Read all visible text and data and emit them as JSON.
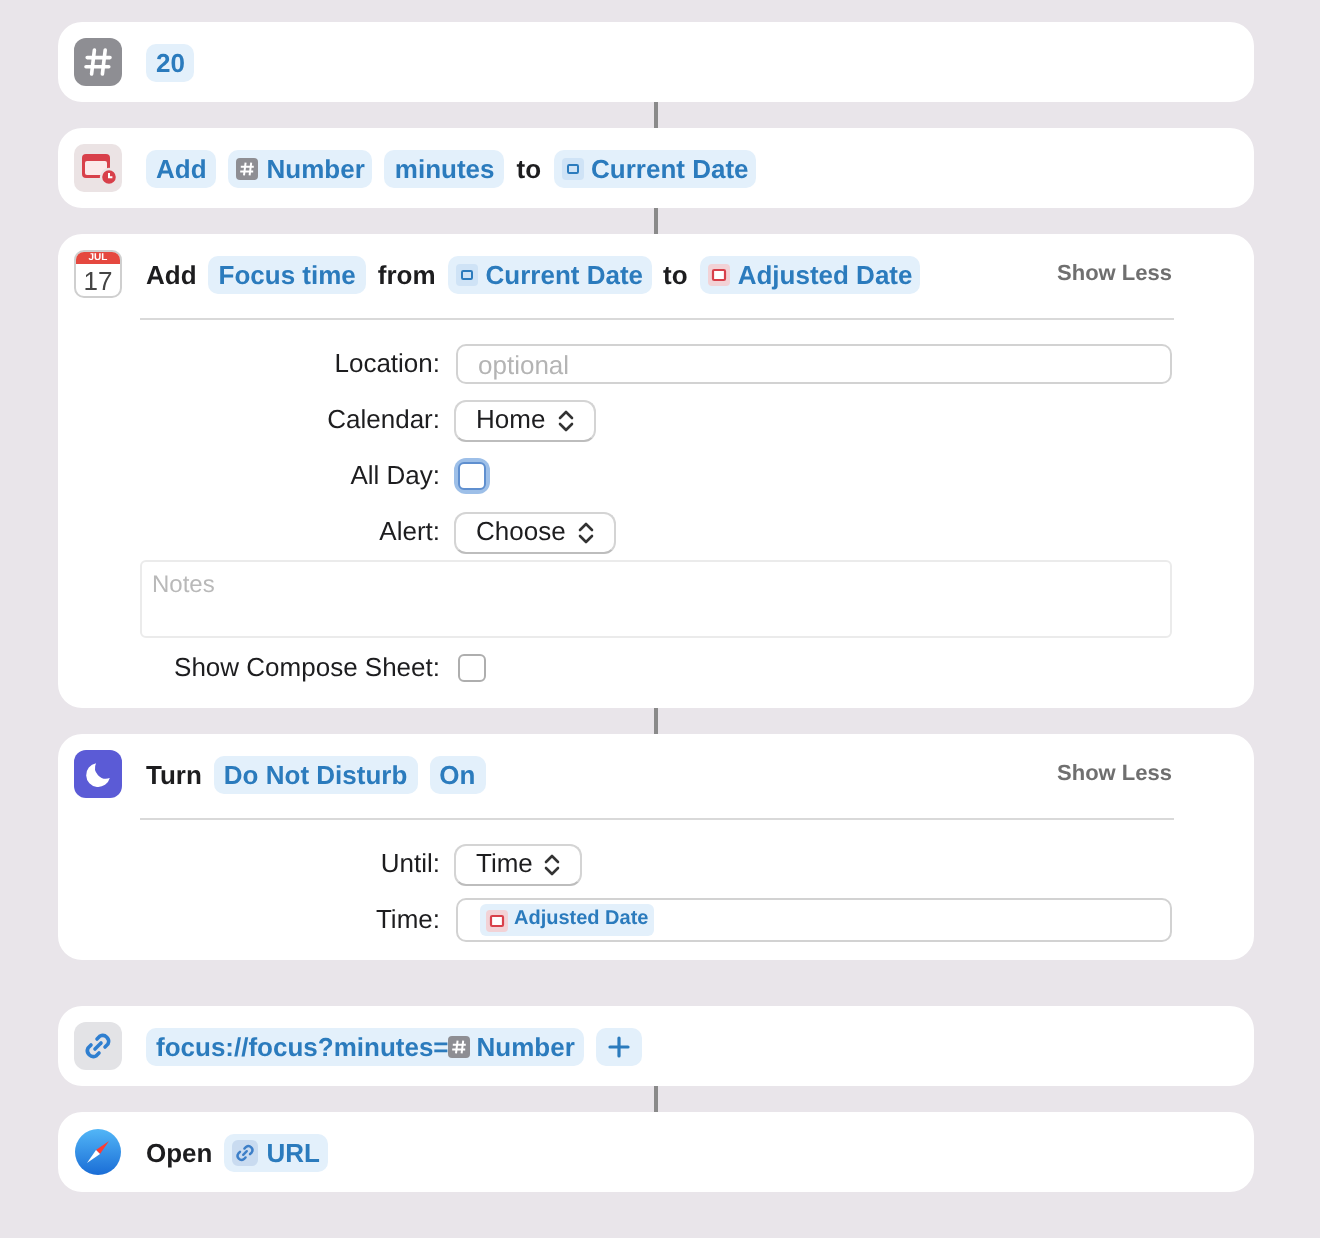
{
  "actions": [
    {
      "kind": "number",
      "linked_to_next": true,
      "summary": [
        {
          "kind": "token",
          "text": "20"
        }
      ]
    },
    {
      "kind": "adjust_date",
      "linked_to_next": true,
      "summary": [
        {
          "kind": "token",
          "text": "Add"
        },
        {
          "kind": "number",
          "text": "Number"
        },
        {
          "kind": "token",
          "text": "minutes"
        },
        {
          "kind": "word",
          "text": "to"
        },
        {
          "kind": "date",
          "text": "Current Date"
        }
      ]
    },
    {
      "kind": "calendar",
      "icon_month": "JUL",
      "icon_day": "17",
      "linked_to_next": true,
      "summary": [
        {
          "kind": "word",
          "text": "Add"
        },
        {
          "kind": "token",
          "text": "Focus time"
        },
        {
          "kind": "word",
          "text": "from"
        },
        {
          "kind": "date",
          "text": "Current Date"
        },
        {
          "kind": "word",
          "text": "to"
        },
        {
          "kind": "adjusted",
          "text": "Adjusted Date"
        }
      ],
      "toggle": "Show Less",
      "fields": [
        {
          "kind": "text",
          "label": "Location:",
          "placeholder": "optional"
        },
        {
          "kind": "popup",
          "label": "Calendar:",
          "value": "Home"
        },
        {
          "kind": "checkbox",
          "label": "All Day:",
          "checked": false,
          "focused": true
        },
        {
          "kind": "popup",
          "label": "Alert:",
          "value": "Choose"
        },
        {
          "kind": "notes",
          "placeholder": "Notes"
        },
        {
          "kind": "checkbox",
          "label": "Show Compose Sheet:",
          "checked": false,
          "focused": false
        }
      ]
    },
    {
      "kind": "focus",
      "linked_to_next": false,
      "summary": [
        {
          "kind": "word",
          "text": "Turn"
        },
        {
          "kind": "token",
          "text": "Do Not Disturb"
        },
        {
          "kind": "token",
          "text": "On"
        }
      ],
      "toggle": "Show Less",
      "fields": [
        {
          "kind": "popup",
          "label": "Until:",
          "value": "Time"
        },
        {
          "kind": "variable_field",
          "label": "Time:",
          "variable": {
            "kind": "adjusted",
            "text": "Adjusted Date"
          }
        }
      ]
    },
    {
      "kind": "url",
      "linked_to_next": true,
      "summary": [
        {
          "kind": "url_field",
          "parts": [
            {
              "kind": "text",
              "text": "focus://focus?minutes="
            },
            {
              "kind": "number",
              "text": "Number"
            }
          ]
        },
        {
          "kind": "add_button"
        }
      ]
    },
    {
      "kind": "safari",
      "linked_to_next": false,
      "summary": [
        {
          "kind": "word",
          "text": "Open"
        },
        {
          "kind": "url",
          "text": "URL"
        }
      ]
    }
  ]
}
